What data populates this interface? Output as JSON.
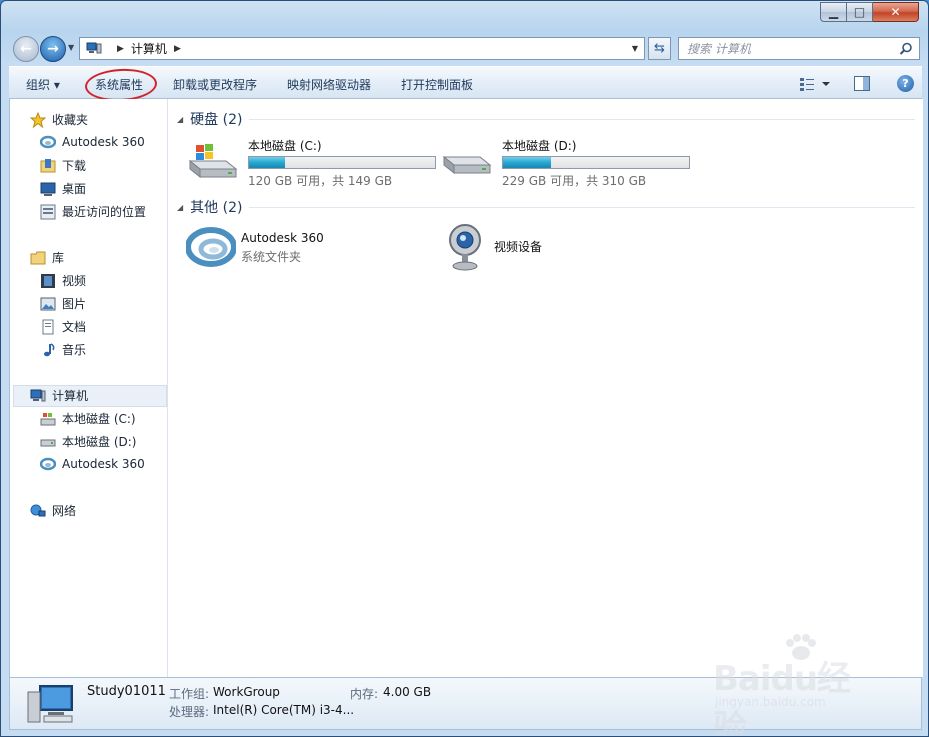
{
  "window": {
    "minimize": "▁",
    "maximize": "□",
    "close": "✕"
  },
  "address": {
    "crumb": "计算机",
    "search_placeholder": "搜索 计算机"
  },
  "toolbar": {
    "organize": "组织 ▾",
    "system_properties": "系统属性",
    "uninstall": "卸载或更改程序",
    "map_drive": "映射网络驱动器",
    "control_panel": "打开控制面板",
    "help": "?"
  },
  "sidebar": {
    "favorites": {
      "label": "收藏夹",
      "items": [
        "Autodesk 360",
        "下载",
        "桌面",
        "最近访问的位置"
      ]
    },
    "libraries": {
      "label": "库",
      "items": [
        "视频",
        "图片",
        "文档",
        "音乐"
      ]
    },
    "computer": {
      "label": "计算机",
      "items": [
        "本地磁盘 (C:)",
        "本地磁盘 (D:)",
        "Autodesk 360"
      ]
    },
    "network": {
      "label": "网络"
    }
  },
  "main": {
    "hard_drives": {
      "header": "硬盘 (2)",
      "drives": [
        {
          "name": "本地磁盘 (C:)",
          "capacity": "120 GB 可用，共 149 GB",
          "used_fraction": 0.195
        },
        {
          "name": "本地磁盘 (D:)",
          "capacity": "229 GB 可用，共 310 GB",
          "used_fraction": 0.26
        }
      ]
    },
    "other": {
      "header": "其他 (2)",
      "items": [
        {
          "name": "Autodesk 360",
          "sub": "系统文件夹"
        },
        {
          "name": "视频设备",
          "sub": ""
        }
      ]
    }
  },
  "details": {
    "computer_name": "Study01011",
    "workgroup_label": "工作组:",
    "workgroup": "WorkGroup",
    "memory_label": "内存:",
    "memory": "4.00 GB",
    "processor_label": "处理器:",
    "processor": "Intel(R) Core(TM) i3-4..."
  },
  "watermark": {
    "main": "Baidu经验",
    "sub": "jingyan.baidu.com"
  },
  "colors": {
    "annotation_circle": "#d2232a",
    "drive_fill": "#27a7cf"
  }
}
